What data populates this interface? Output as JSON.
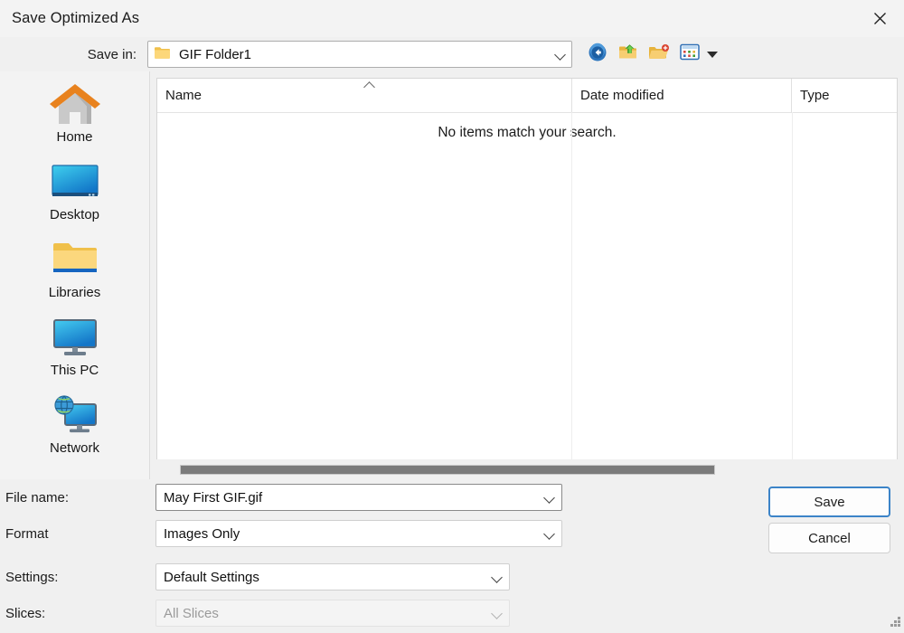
{
  "window": {
    "title": "Save Optimized As",
    "close_icon": "close-icon"
  },
  "savein": {
    "label": "Save in:",
    "value": "GIF Folder1",
    "folder_icon": "folder-icon",
    "dropdown_icon": "chevron-down-icon"
  },
  "toolbar": {
    "buttons": [
      {
        "name": "back-button",
        "icon": "back-arrow-icon",
        "label": "Back"
      },
      {
        "name": "up-one-level-button",
        "icon": "up-folder-icon",
        "label": "Up One Level"
      },
      {
        "name": "create-new-folder-button",
        "icon": "new-folder-icon",
        "label": "Create New Folder"
      },
      {
        "name": "view-menu-button",
        "icon": "view-list-icon",
        "label": "View Menu"
      }
    ],
    "view_caret_icon": "caret-down-icon"
  },
  "places": {
    "items": [
      {
        "label": "Home",
        "icon": "home-icon"
      },
      {
        "label": "Desktop",
        "icon": "desktop-icon"
      },
      {
        "label": "Libraries",
        "icon": "libraries-folder-icon"
      },
      {
        "label": "This PC",
        "icon": "this-pc-monitor-icon"
      },
      {
        "label": "Network",
        "icon": "network-globe-icon"
      }
    ]
  },
  "filelist": {
    "columns": [
      "Name",
      "Date modified",
      "Type"
    ],
    "sort_icon": "sort-ascending-icon",
    "empty_message": "No items match your search.",
    "rows": [],
    "scrollbar": {
      "name": "horizontal-scrollbar",
      "thumb_icon": "scroll-thumb"
    }
  },
  "form": {
    "filename": {
      "label": "File name:",
      "value": "May First GIF.gif",
      "dropdown_icon": "chevron-down-icon"
    },
    "format": {
      "label": "Format",
      "value": "Images Only",
      "dropdown_icon": "chevron-down-icon"
    },
    "settings": {
      "label": "Settings:",
      "value": "Default Settings",
      "dropdown_icon": "chevron-down-icon"
    },
    "slices": {
      "label": "Slices:",
      "value": "All Slices",
      "dropdown_icon": "chevron-down-icon",
      "disabled": true
    }
  },
  "buttons": {
    "save": "Save",
    "cancel": "Cancel"
  },
  "colors": {
    "accent": "#3c84c8",
    "dialog_bg": "#f0f0f0",
    "titlebar_bg": "#f3f3f3",
    "list_bg": "#ffffff",
    "scroll_thumb": "#7b7b7b"
  },
  "resize_grip": {
    "name": "resize-grip",
    "icon": "resize-grip-icon"
  }
}
